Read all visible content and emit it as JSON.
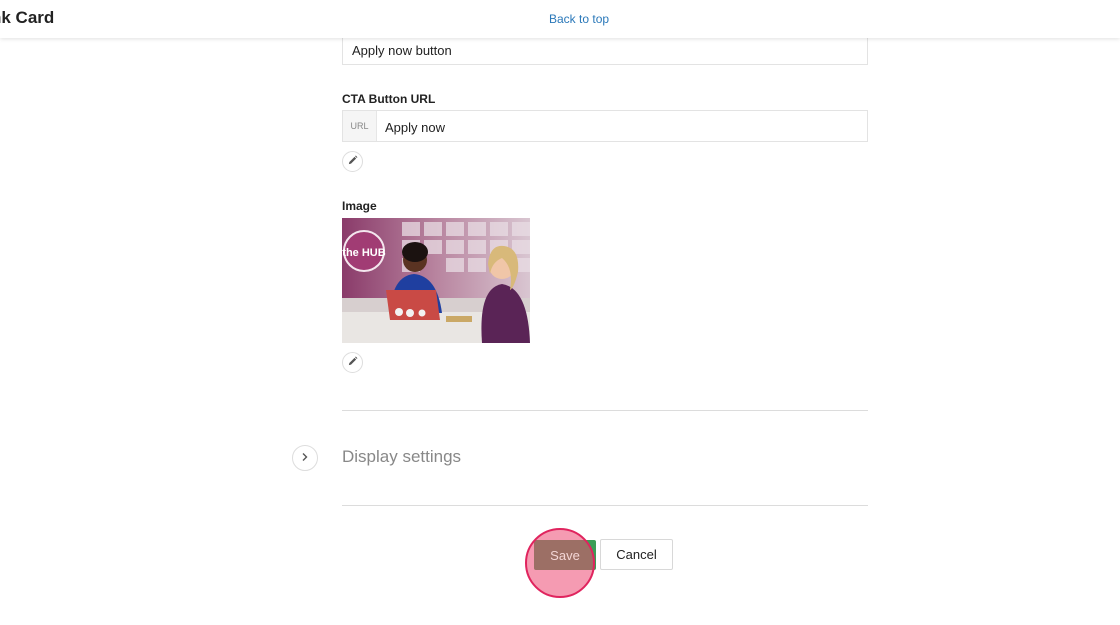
{
  "header": {
    "title": "nk Card",
    "back_to_top": "Back to top"
  },
  "cta_text_field": {
    "value": "Apply now button"
  },
  "cta_url": {
    "label": "CTA Button URL",
    "prefix": "URL",
    "value": "Apply now"
  },
  "image_section": {
    "label": "Image",
    "photo_sign_text": "the HUB"
  },
  "display_settings": {
    "title": "Display settings"
  },
  "actions": {
    "save_label": "Save",
    "cancel_label": "Cancel"
  },
  "colors": {
    "link": "#2a78b9",
    "save_button": "#3a9e56",
    "click_highlight": "#e0245e"
  }
}
